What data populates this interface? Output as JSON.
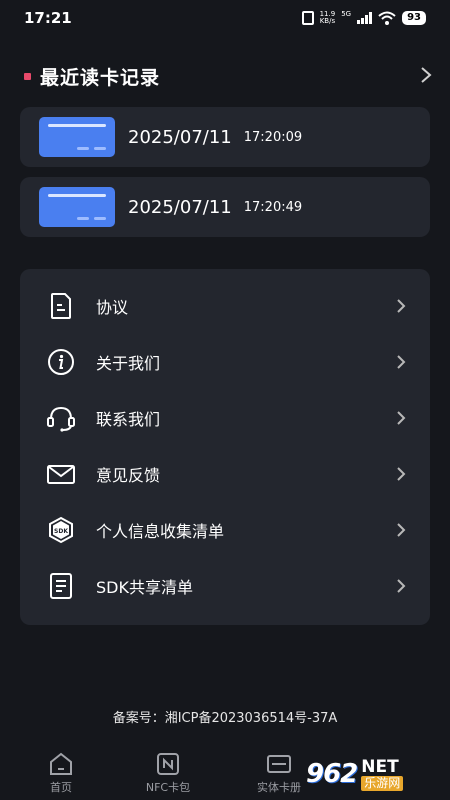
{
  "status_bar": {
    "time": "17:21",
    "net_speed_value": "11.9",
    "net_speed_unit": "KB/s",
    "signal_label": "5G",
    "battery": "93"
  },
  "recent": {
    "title": "最近读卡记录",
    "accent_color": "#e84a6b",
    "records": [
      {
        "date": "2025/07/11",
        "time": "17:20:09"
      },
      {
        "date": "2025/07/11",
        "time": "17:20:49"
      }
    ]
  },
  "menu": {
    "items": [
      {
        "label": "协议",
        "icon": "document-icon"
      },
      {
        "label": "关于我们",
        "icon": "info-icon"
      },
      {
        "label": "联系我们",
        "icon": "headset-icon"
      },
      {
        "label": "意见反馈",
        "icon": "mail-icon"
      },
      {
        "label": "个人信息收集清单",
        "icon": "sdk-cube-icon"
      },
      {
        "label": "SDK共享清单",
        "icon": "list-document-icon"
      }
    ]
  },
  "footer": {
    "record_text": "备案号：湘ICP备2023036514号-37A"
  },
  "tabbar": {
    "tabs": [
      {
        "label": "首页",
        "icon": "home-icon"
      },
      {
        "label": "NFC卡包",
        "icon": "nfc-icon"
      },
      {
        "label": "实体卡册",
        "icon": "card-album-icon"
      }
    ]
  },
  "watermark": {
    "logo_number": "962",
    "logo_net": "NET",
    "logo_cn": "乐游网"
  },
  "colors": {
    "background": "#15171c",
    "card_bg": "#23262e",
    "card_icon_blue": "#4a7ff0"
  }
}
